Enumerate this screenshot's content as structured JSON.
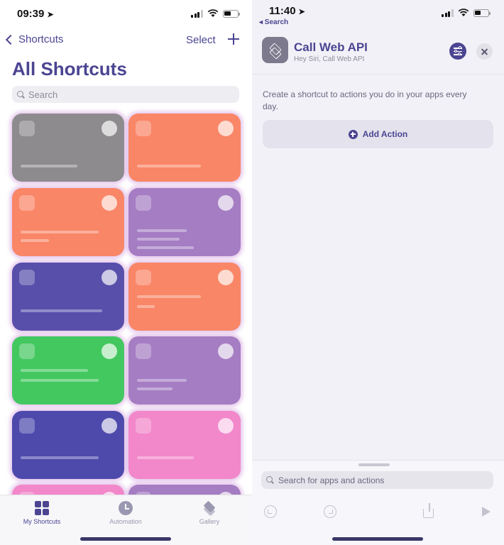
{
  "left": {
    "status": {
      "time": "09:39"
    },
    "nav": {
      "back_label": "Shortcuts",
      "select_label": "Select"
    },
    "title": "All Shortcuts",
    "search": {
      "placeholder": "Search"
    },
    "cards": [
      {
        "color": "#8e8b8e"
      },
      {
        "color": "#f5876a"
      },
      {
        "color": "#f5876a"
      },
      {
        "color": "#a47ec0"
      },
      {
        "color": "#574fa6"
      },
      {
        "color": "#f5876a"
      },
      {
        "color": "#48c663"
      },
      {
        "color": "#a47ec0"
      },
      {
        "color": "#4d4aa8"
      },
      {
        "color": "#ee88c8"
      },
      {
        "color": "#ee88c8"
      },
      {
        "color": "#a47ec0"
      }
    ],
    "tabs": [
      {
        "label": "My Shortcuts",
        "active": true
      },
      {
        "label": "Automation",
        "active": false
      },
      {
        "label": "Gallery",
        "active": false
      }
    ]
  },
  "right": {
    "status": {
      "time": "11:40",
      "back_app": "◂ Search"
    },
    "shortcut": {
      "name": "Call Web API",
      "subtitle": "Hey Siri, Call Web API"
    },
    "help_text": "Create a shortcut to actions you do in your apps every day.",
    "add_action_label": "Add Action",
    "search": {
      "placeholder": "Search for apps and actions"
    }
  },
  "colors": {
    "accent": "#4b4592",
    "card_orange": "#f5876a",
    "card_purple": "#a47ec0",
    "card_green": "#48c663",
    "card_pink": "#ee88c8",
    "card_indigo": "#574fa6"
  }
}
